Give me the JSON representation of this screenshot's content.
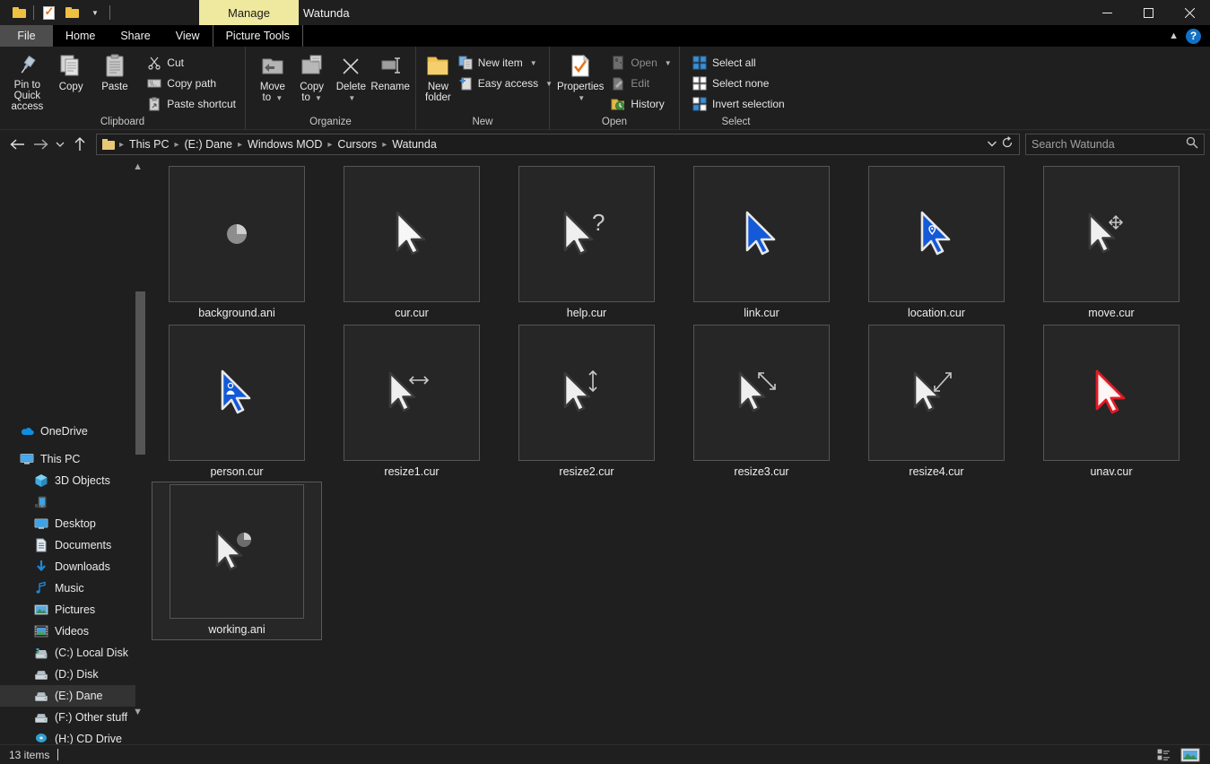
{
  "window": {
    "title": "Watunda",
    "contextual_tab": "Manage",
    "quick_access": [
      "save-icon",
      "properties-icon",
      "new-folder-icon",
      "customize-caret-icon"
    ],
    "controls": {
      "minimize": "minimize-icon",
      "maximize": "maximize-icon",
      "close": "close-icon"
    }
  },
  "tabs": [
    {
      "label": "File",
      "active": true
    },
    {
      "label": "Home",
      "active": false
    },
    {
      "label": "Share",
      "active": false
    },
    {
      "label": "View",
      "active": false
    },
    {
      "label": "Picture Tools",
      "active": false
    }
  ],
  "tabbar_right": {
    "collapse": "chevron-up-icon",
    "help": "?"
  },
  "ribbon": {
    "groups": [
      {
        "label": "Clipboard",
        "big": [
          {
            "label": "Pin to Quick\naccess",
            "icon": "pin-icon"
          },
          {
            "label": "Copy",
            "icon": "copy-icon"
          },
          {
            "label": "Paste",
            "icon": "paste-icon"
          }
        ],
        "small": [
          {
            "label": "Cut",
            "icon": "scissors-icon"
          },
          {
            "label": "Copy path",
            "icon": "copy-path-icon"
          },
          {
            "label": "Paste shortcut",
            "icon": "paste-shortcut-icon"
          }
        ]
      },
      {
        "label": "Organize",
        "big": [
          {
            "label": "Move\nto",
            "icon": "move-to-icon",
            "caret": true
          },
          {
            "label": "Copy\nto",
            "icon": "copy-to-icon",
            "caret": true
          },
          {
            "label": "Delete",
            "icon": "delete-icon",
            "caret": true
          },
          {
            "label": "Rename",
            "icon": "rename-icon"
          }
        ],
        "small": []
      },
      {
        "label": "New",
        "big": [
          {
            "label": "New\nfolder",
            "icon": "new-folder-icon"
          }
        ],
        "small": [
          {
            "label": "New item",
            "icon": "new-item-icon",
            "caret": true
          },
          {
            "label": "Easy access",
            "icon": "easy-access-icon",
            "caret": true
          }
        ]
      },
      {
        "label": "Open",
        "big": [
          {
            "label": "Properties",
            "icon": "properties-icon",
            "caret": true
          }
        ],
        "small": [
          {
            "label": "Open",
            "icon": "open-icon",
            "caret": true,
            "dim": true
          },
          {
            "label": "Edit",
            "icon": "edit-icon",
            "dim": true
          },
          {
            "label": "History",
            "icon": "history-icon"
          }
        ]
      },
      {
        "label": "Select",
        "big": [],
        "small": [
          {
            "label": "Select all",
            "icon": "select-all-icon"
          },
          {
            "label": "Select none",
            "icon": "select-none-icon"
          },
          {
            "label": "Invert selection",
            "icon": "invert-selection-icon"
          }
        ]
      }
    ]
  },
  "address": {
    "back": "back-arrow-icon",
    "forward": "forward-arrow-icon",
    "recent": "chevron-down-icon",
    "up": "up-arrow-icon",
    "breadcrumbs": [
      "This PC",
      "(E:) Dane",
      "Windows MOD",
      "Cursors",
      "Watunda"
    ],
    "dropdown": "chevron-down-icon",
    "refresh": "refresh-icon"
  },
  "search": {
    "placeholder": "Search Watunda",
    "icon": "search-icon"
  },
  "sidebar": {
    "items": [
      {
        "label": "OneDrive",
        "icon": "onedrive-cloud-icon",
        "indent": false,
        "selected": false,
        "gap_after": true
      },
      {
        "label": "This PC",
        "icon": "this-pc-icon",
        "indent": false,
        "selected": false
      },
      {
        "label": "3D Objects",
        "icon": "3d-objects-icon",
        "indent": true,
        "selected": false
      },
      {
        "label": "",
        "icon": "phone-device-icon",
        "indent": true,
        "selected": false
      },
      {
        "label": "Desktop",
        "icon": "desktop-icon",
        "indent": true,
        "selected": false
      },
      {
        "label": "Documents",
        "icon": "documents-icon",
        "indent": true,
        "selected": false
      },
      {
        "label": "Downloads",
        "icon": "downloads-icon",
        "indent": true,
        "selected": false
      },
      {
        "label": "Music",
        "icon": "music-icon",
        "indent": true,
        "selected": false
      },
      {
        "label": "Pictures",
        "icon": "pictures-icon",
        "indent": true,
        "selected": false
      },
      {
        "label": "Videos",
        "icon": "videos-icon",
        "indent": true,
        "selected": false
      },
      {
        "label": "(C:) Local Disk",
        "icon": "local-disk-icon",
        "indent": true,
        "selected": false
      },
      {
        "label": "(D:) Disk",
        "icon": "drive-icon",
        "indent": true,
        "selected": false
      },
      {
        "label": "(E:) Dane",
        "icon": "drive-icon",
        "indent": true,
        "selected": true
      },
      {
        "label": "(F:) Other stuff",
        "icon": "drive-icon",
        "indent": true,
        "selected": false
      },
      {
        "label": "(H:) CD Drive",
        "icon": "cd-drive-icon",
        "indent": true,
        "selected": false
      }
    ]
  },
  "files": [
    {
      "name": "background.ani",
      "icon": "busy-disc-cursor",
      "selected": false
    },
    {
      "name": "cur.cur",
      "icon": "arrow-cursor",
      "selected": false
    },
    {
      "name": "help.cur",
      "icon": "help-cursor",
      "selected": false
    },
    {
      "name": "link.cur",
      "icon": "link-cursor",
      "selected": false
    },
    {
      "name": "location.cur",
      "icon": "location-cursor",
      "selected": false
    },
    {
      "name": "move.cur",
      "icon": "move-cursor",
      "selected": false
    },
    {
      "name": "person.cur",
      "icon": "person-cursor",
      "selected": false
    },
    {
      "name": "resize1.cur",
      "icon": "resize-horizontal-cursor",
      "selected": false
    },
    {
      "name": "resize2.cur",
      "icon": "resize-vertical-cursor",
      "selected": false
    },
    {
      "name": "resize3.cur",
      "icon": "resize-diagonal-nesw-cursor",
      "selected": false
    },
    {
      "name": "resize4.cur",
      "icon": "resize-diagonal-nwse-cursor",
      "selected": false
    },
    {
      "name": "unav.cur",
      "icon": "unavailable-cursor",
      "selected": false
    },
    {
      "name": "working.ani",
      "icon": "working-cursor",
      "selected": true
    }
  ],
  "status": {
    "item_count": "13 items",
    "views": [
      {
        "name": "details-view",
        "active": false
      },
      {
        "name": "large-icons-view",
        "active": false
      }
    ]
  },
  "colors": {
    "window_bg": "#1f1f1f",
    "contextual_tab": "#efe9a0",
    "accent_blue": "#1271c4",
    "cursor_blue": "#1359d8",
    "unavailable_red": "#e01b24",
    "selection_bg": "#333333"
  }
}
